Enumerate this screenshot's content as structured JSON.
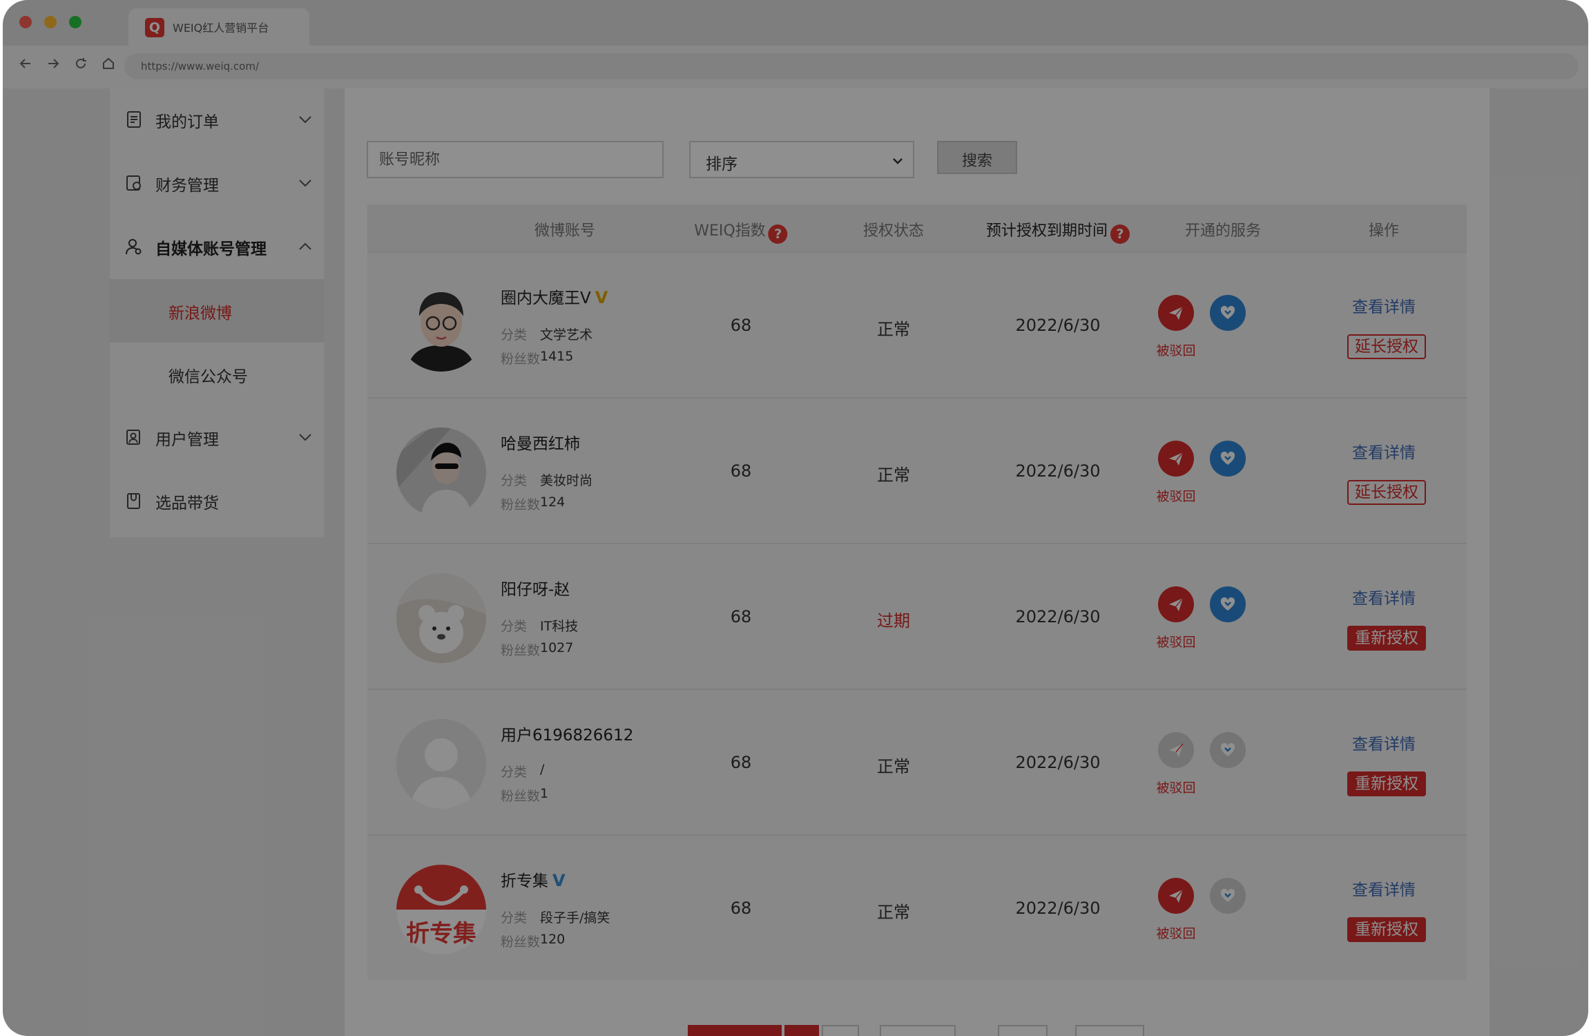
{
  "browser": {
    "tab_title": "WEIQ红人营销平台",
    "tab_logo": "Q",
    "url": "https://www.weiq.com/",
    "traffic_lights": [
      "#ff5f57",
      "#febc2e",
      "#28c840"
    ],
    "nav_icons": [
      "back-arrow-icon",
      "forward-arrow-icon",
      "reload-icon",
      "home-icon"
    ]
  },
  "sidebar": {
    "items": [
      {
        "label": "我的订单",
        "icon": "document-icon",
        "expanded": false
      },
      {
        "label": "财务管理",
        "icon": "finance-icon",
        "expanded": false
      },
      {
        "label": "自媒体账号管理",
        "icon": "user-icon",
        "expanded": true
      },
      {
        "label": "用户管理",
        "icon": "user-card-icon",
        "expanded": false
      },
      {
        "label": "选品带货",
        "icon": "bag-icon",
        "expanded": null
      }
    ],
    "subitems": [
      {
        "label": "新浪微博",
        "active": true
      },
      {
        "label": "微信公众号",
        "active": false
      }
    ]
  },
  "filters": {
    "search_placeholder": "账号昵称",
    "sort_label": "排序",
    "search_button": "搜索"
  },
  "table": {
    "columns": [
      "微博账号",
      "WEIQ指数",
      "授权状态",
      "预计授权到期时间",
      "开通的服务",
      "操作"
    ],
    "help_icon_label": "?",
    "rows": [
      {
        "name": "圈内大魔王V",
        "verified": "V",
        "verified_color": "#e0a800",
        "category_label": "分类",
        "category": "文学艺术",
        "fans_label": "粉丝数",
        "fans": "1415",
        "weiq_index": "68",
        "status": "正常",
        "expired": false,
        "expiry": "2022/6/30",
        "service_send": true,
        "service_heart": true,
        "rejected": "被驳回",
        "detail_link": "查看详情",
        "action": "延长授权",
        "action_style": "outline",
        "avatar": "cartoon-avatar"
      },
      {
        "name": "哈曼西红柿",
        "verified": "",
        "verified_color": "",
        "category_label": "分类",
        "category": "美妆时尚",
        "fans_label": "粉丝数",
        "fans": "124",
        "weiq_index": "68",
        "status": "正常",
        "expired": false,
        "expiry": "2022/6/30",
        "service_send": true,
        "service_heart": true,
        "rejected": "被驳回",
        "detail_link": "查看详情",
        "action": "延长授权",
        "action_style": "outline",
        "avatar": "photo-avatar"
      },
      {
        "name": "阳仔呀-赵",
        "verified": "",
        "verified_color": "",
        "category_label": "分类",
        "category": "IT科技",
        "fans_label": "粉丝数",
        "fans": "1027",
        "weiq_index": "68",
        "status": "过期",
        "expired": true,
        "expiry": "2022/6/30",
        "service_send": true,
        "service_heart": true,
        "rejected": "被驳回",
        "detail_link": "查看详情",
        "action": "重新授权",
        "action_style": "solid",
        "avatar": "bear-avatar"
      },
      {
        "name": "用户6196826612",
        "verified": "",
        "verified_color": "",
        "category_label": "分类",
        "category": "/",
        "fans_label": "粉丝数",
        "fans": "1",
        "weiq_index": "68",
        "status": "正常",
        "expired": false,
        "expiry": "2022/6/30",
        "service_send": false,
        "service_heart": false,
        "rejected": "被驳回",
        "detail_link": "查看详情",
        "action": "重新授权",
        "action_style": "solid",
        "avatar": "default-avatar"
      },
      {
        "name": "折专集",
        "verified": "V",
        "verified_color": "#3a8fd6",
        "category_label": "分类",
        "category": "段子手/搞笑",
        "fans_label": "粉丝数",
        "fans": "120",
        "weiq_index": "68",
        "status": "正常",
        "expired": false,
        "expiry": "2022/6/30",
        "service_send": true,
        "service_heart": false,
        "rejected": "被驳回",
        "detail_link": "查看详情",
        "action": "重新授权",
        "action_style": "solid",
        "avatar": "brand-avatar",
        "avatar_text": "折专集"
      }
    ]
  },
  "colors": {
    "accent_red": "#d72b2b",
    "link_blue": "#3d6ab5",
    "service_blue": "#2f86d6",
    "service_disabled": "#cfcfcf"
  }
}
